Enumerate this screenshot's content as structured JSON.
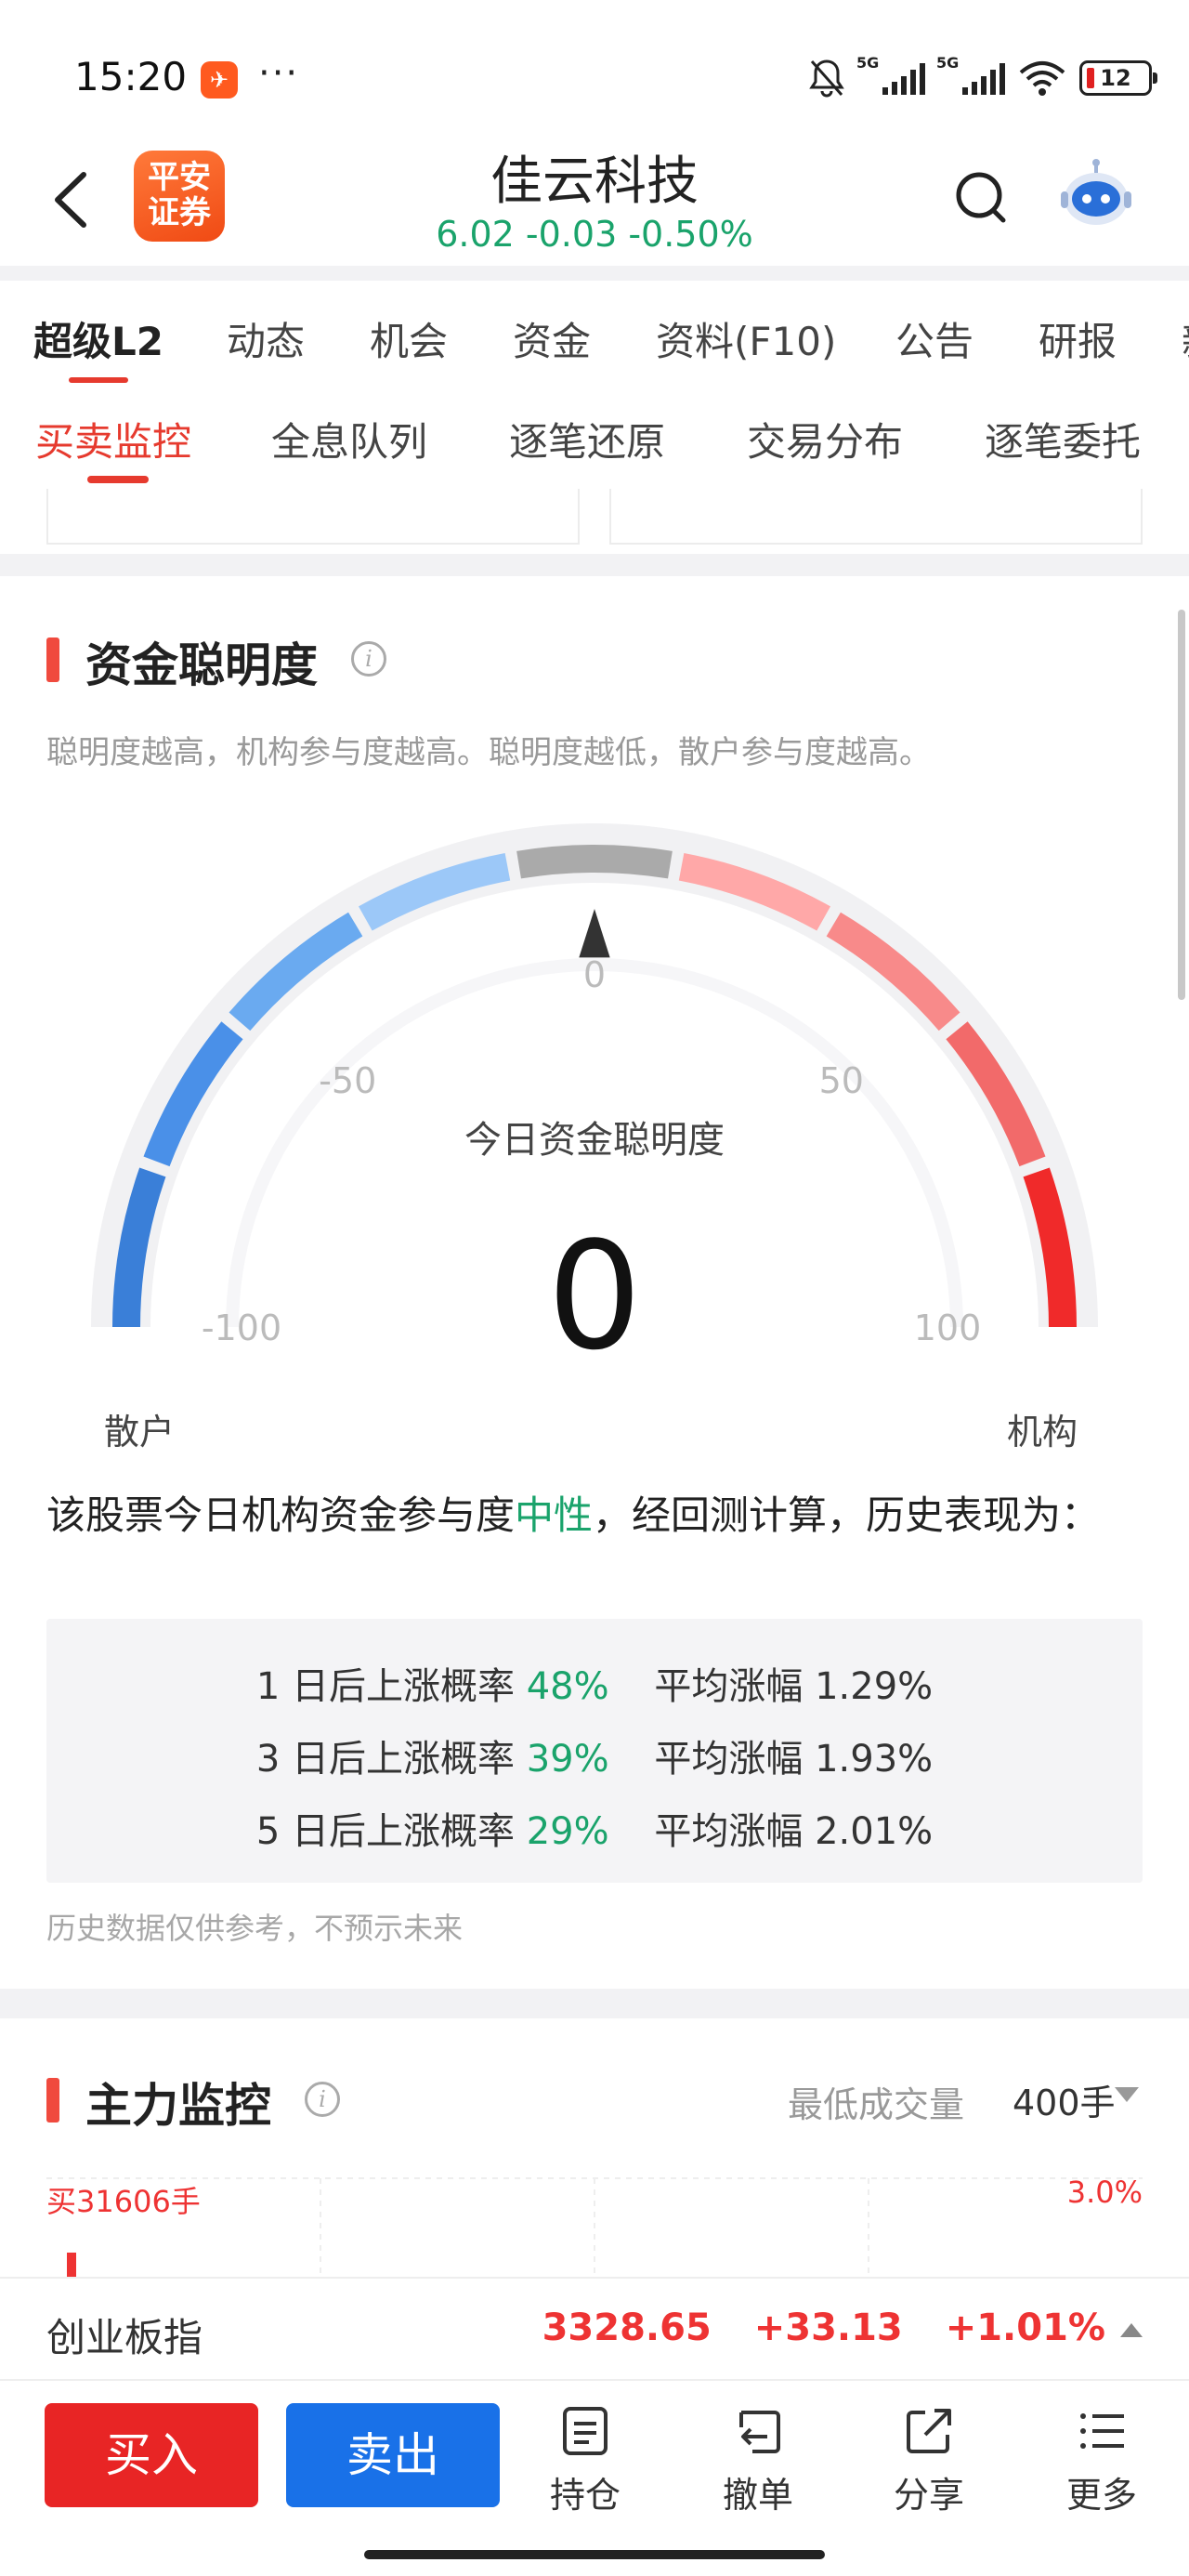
{
  "status_bar": {
    "time": "15:20",
    "notif_icon": "paper-plane-icon",
    "more": "···",
    "net1": "5G",
    "net2": "5G",
    "battery": "12"
  },
  "header": {
    "logo_line1": "平安",
    "logo_line2": "证券",
    "stock_name": "佳云科技",
    "quote": "6.02  -0.03  -0.50%",
    "quote_color": "#1aa36b"
  },
  "main_tabs": [
    "超级L2",
    "动态",
    "机会",
    "资金",
    "资料(F10)",
    "公告",
    "研报",
    "新"
  ],
  "sub_tabs": [
    "买卖监控",
    "全息队列",
    "逐笔还原",
    "交易分布",
    "逐笔委托"
  ],
  "smart_money": {
    "title": "资金聪明度",
    "description": "聪明度越高，机构参与度越高。聪明度越低，散户参与度越高。",
    "gauge": {
      "min": -100,
      "max": 100,
      "value": 0,
      "tick_labels": [
        "-100",
        "-50",
        "0",
        "50",
        "100"
      ],
      "center_label": "今日资金聪明度",
      "value_text": "0",
      "left_end": "散户",
      "right_end": "机构",
      "colors": [
        "#3a7fd8",
        "#4a90e8",
        "#6aaaf0",
        "#9cc8f8",
        "#aaaaaa",
        "#ffa8a8",
        "#f88a8a",
        "#f26a6a",
        "#f02a2a"
      ]
    },
    "conclusion_pre": "该股票今日机构资金参与度",
    "conclusion_hl": "中性",
    "conclusion_post": "，经回测计算，历史表现为：",
    "stats": [
      {
        "label": "1 日后上涨概率",
        "rate": "48%",
        "avg_label": "平均涨幅",
        "avg": "1.29%"
      },
      {
        "label": "3 日后上涨概率",
        "rate": "39%",
        "avg_label": "平均涨幅",
        "avg": "1.93%"
      },
      {
        "label": "5 日后上涨概率",
        "rate": "29%",
        "avg_label": "平均涨幅",
        "avg": "2.01%"
      }
    ],
    "note": "历史数据仅供参考，不预示未来"
  },
  "main_monitor": {
    "title": "主力监控",
    "min_vol_label": "最低成交量",
    "min_vol_value": "400手",
    "buy_vol": "买31606手",
    "pct_max": "3.0%"
  },
  "index_bar": {
    "name": "创业板指",
    "value": "3328.65",
    "change": "+33.13",
    "pct": "+1.01%"
  },
  "bottom_bar": {
    "buy": "买入",
    "sell": "卖出",
    "positions": "持仓",
    "cancel": "撤单",
    "share": "分享",
    "more": "更多"
  }
}
